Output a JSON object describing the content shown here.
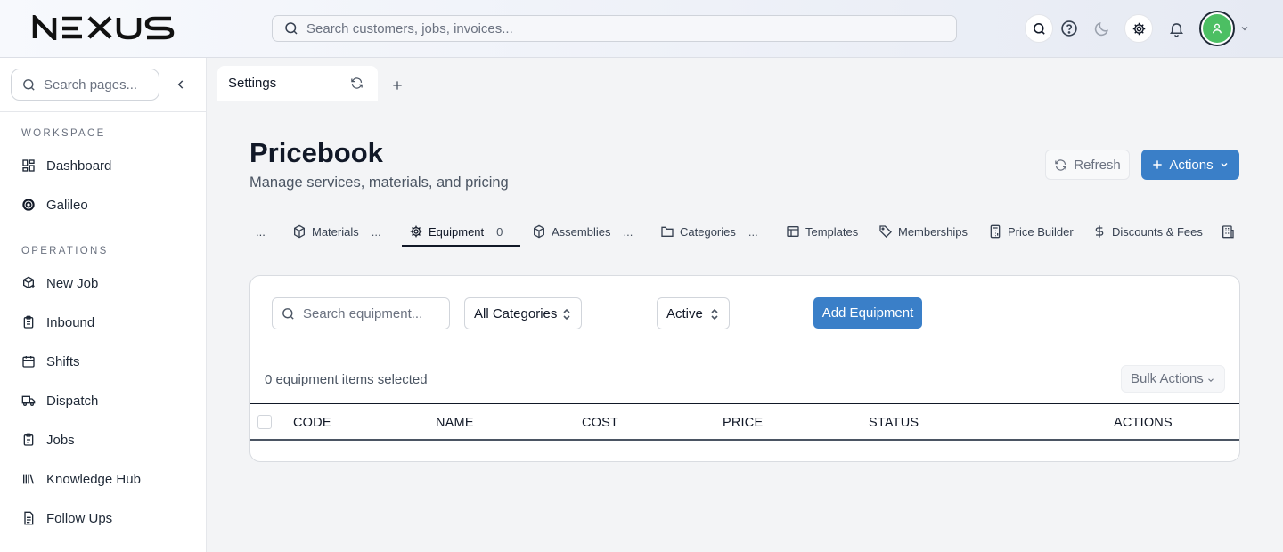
{
  "app": {
    "logo_text": "NEXUS"
  },
  "header": {
    "search_placeholder": "Search customers, jobs, invoices..."
  },
  "sidebar": {
    "search_placeholder": "Search pages...",
    "sections": [
      {
        "label": "WORKSPACE",
        "items": [
          {
            "label": "Dashboard",
            "icon": "dashboard-icon"
          },
          {
            "label": "Galileo",
            "icon": "galileo-icon"
          }
        ]
      },
      {
        "label": "OPERATIONS",
        "items": [
          {
            "label": "New Job",
            "icon": "new-job-icon"
          },
          {
            "label": "Inbound",
            "icon": "inbound-icon"
          },
          {
            "label": "Shifts",
            "icon": "calendar-icon"
          },
          {
            "label": "Dispatch",
            "icon": "truck-icon"
          },
          {
            "label": "Jobs",
            "icon": "clipboard-icon"
          },
          {
            "label": "Knowledge Hub",
            "icon": "library-icon"
          },
          {
            "label": "Follow Ups",
            "icon": "document-icon"
          }
        ]
      }
    ]
  },
  "doc_tabs": [
    {
      "label": "Settings"
    }
  ],
  "page": {
    "title": "Pricebook",
    "subtitle": "Manage services, materials, and pricing",
    "refresh_label": "Refresh",
    "actions_label": "Actions"
  },
  "section_tabs": [
    {
      "label": "...",
      "icon": ""
    },
    {
      "label": "Materials",
      "icon": "box-icon",
      "count": "..."
    },
    {
      "label": "Equipment",
      "icon": "gear-icon",
      "count": "0",
      "active": true
    },
    {
      "label": "Assemblies",
      "icon": "box-icon",
      "count": "..."
    },
    {
      "label": "Categories",
      "icon": "folder-icon",
      "count": "..."
    },
    {
      "label": "Templates",
      "icon": "table-icon"
    },
    {
      "label": "Memberships",
      "icon": "tag-icon"
    },
    {
      "label": "Price Builder",
      "icon": "calculator-icon"
    },
    {
      "label": "Discounts & Fees",
      "icon": "dollar-icon"
    },
    {
      "label": "",
      "icon": "building-icon"
    }
  ],
  "equipment": {
    "search_placeholder": "Search equipment...",
    "category_filter": "All Categories",
    "status_filter": "Active",
    "add_label": "Add Equipment",
    "selected_text": "0 equipment items selected",
    "bulk_label": "Bulk Actions",
    "columns": [
      "CODE",
      "NAME",
      "COST",
      "PRICE",
      "STATUS",
      "ACTIONS"
    ],
    "rows": []
  },
  "colors": {
    "primary": "#3a7fc8",
    "avatar": "#4cbf63",
    "text": "#111827"
  }
}
